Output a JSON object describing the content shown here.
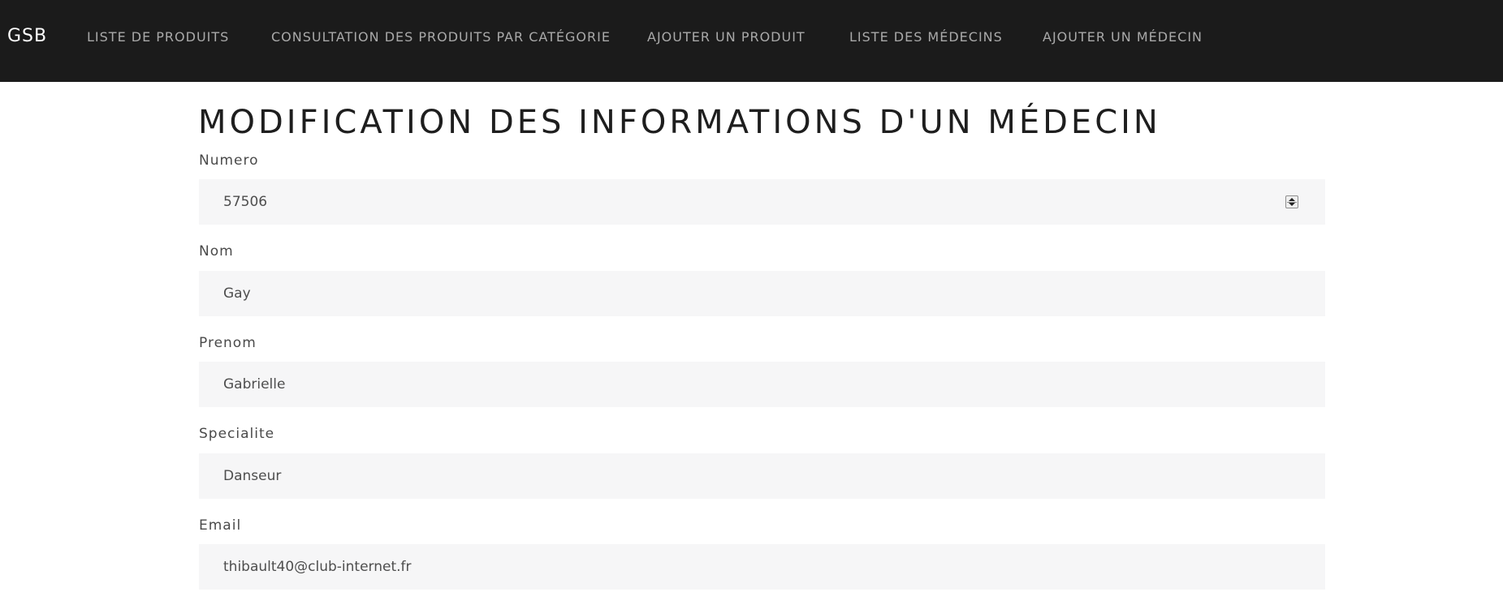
{
  "navbar": {
    "brand": "GSB",
    "links": [
      "LISTE DE PRODUITS",
      "CONSULTATION DES PRODUITS PAR CATÉGORIE",
      "AJOUTER UN PRODUIT",
      "LISTE DES MÉDECINS",
      "AJOUTER UN MÉDECIN"
    ]
  },
  "page": {
    "title": "MODIFICATION DES INFORMATIONS D'UN MÉDECIN"
  },
  "form": {
    "fields": [
      {
        "label": "Numero",
        "value": "57506",
        "type": "number"
      },
      {
        "label": "Nom",
        "value": "Gay",
        "type": "text"
      },
      {
        "label": "Prenom",
        "value": "Gabrielle",
        "type": "text"
      },
      {
        "label": "Specialite",
        "value": "Danseur",
        "type": "text"
      },
      {
        "label": "Email",
        "value": "thibault40@club-internet.fr",
        "type": "email"
      }
    ]
  },
  "colors": {
    "navbar_bg": "#1b1b1b",
    "nav_link": "#a9a9a9",
    "input_bg": "#f6f6f7",
    "title": "#1e1e1e"
  }
}
